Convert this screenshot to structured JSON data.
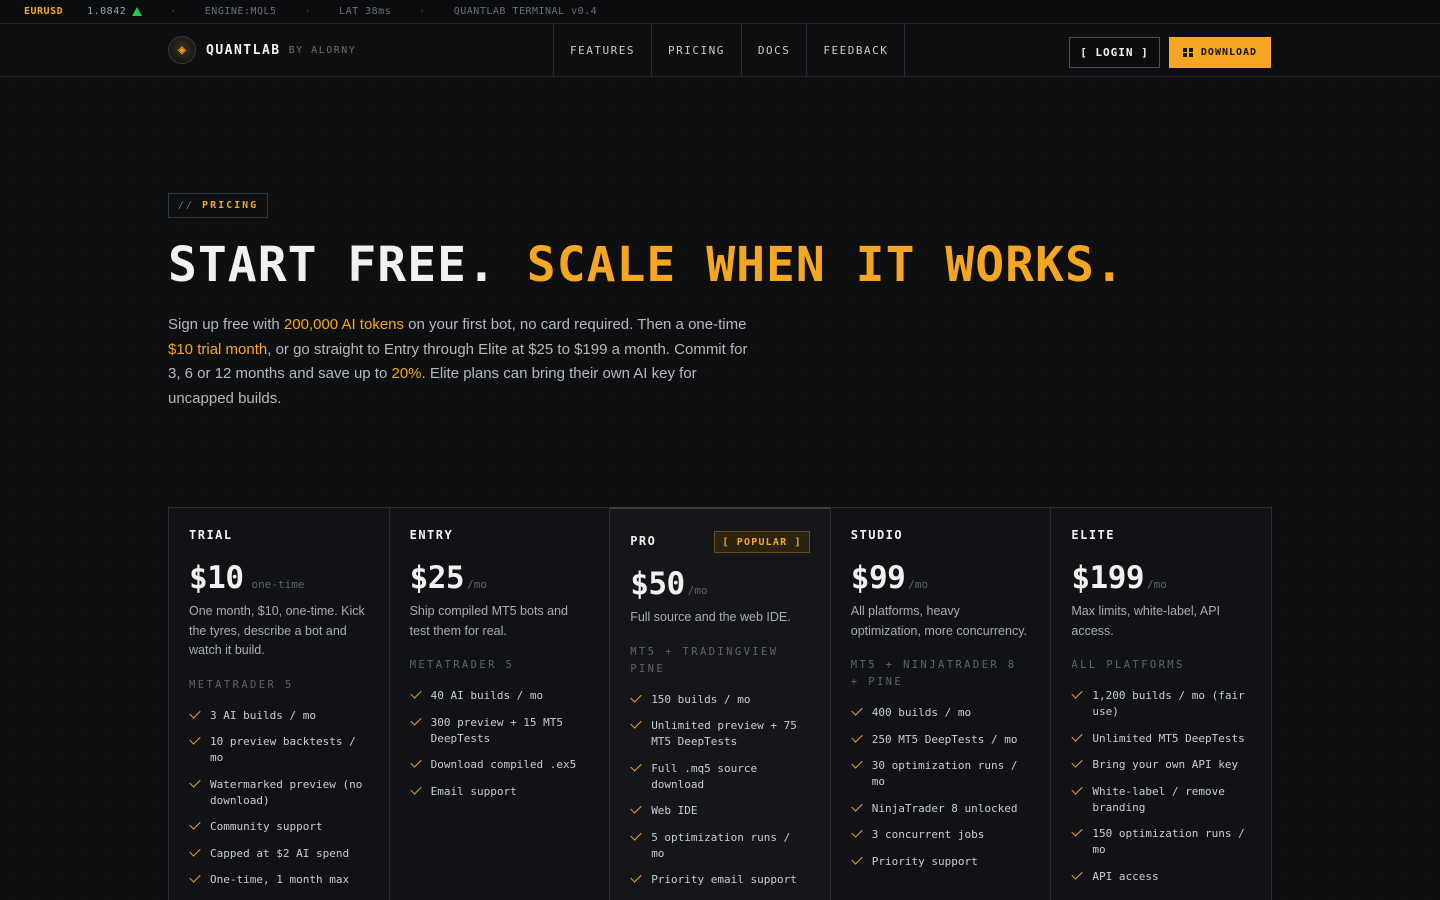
{
  "ticker": {
    "symbol": "EURUSD",
    "price": "1.0842",
    "engine": "ENGINE:MQL5",
    "latency": "LAT 38ms",
    "terminal": "QUANTLAB TERMINAL v0.4",
    "separator": "·"
  },
  "nav": {
    "brand": "QUANTLAB",
    "brand_by": "BY ALORNY",
    "links": [
      "FEATURES",
      "PRICING",
      "DOCS",
      "FEEDBACK"
    ],
    "login": "[ LOGIN ]",
    "download": "DOWNLOAD"
  },
  "hero": {
    "eyebrow_prefix": "//",
    "eyebrow": "PRICING",
    "headline_white": "START FREE.",
    "headline_orange": "SCALE WHEN IT WORKS.",
    "lede": [
      {
        "t": "Sign up free with ",
        "h": false
      },
      {
        "t": "200,000 AI tokens",
        "h": true
      },
      {
        "t": " on your first bot, no card required. Then a one-time ",
        "h": false
      },
      {
        "t": "$10 trial month",
        "h": true
      },
      {
        "t": ", or go straight to Entry through Elite at $25 to $199 a month. Commit for 3, 6 or 12 months and save up to ",
        "h": false
      },
      {
        "t": "20%",
        "h": true
      },
      {
        "t": ". Elite plans can bring their own AI key for uncapped builds.",
        "h": false
      }
    ]
  },
  "plans": [
    {
      "name": "TRIAL",
      "price": "$10",
      "per": "one-time",
      "desc": "One month, $10, one-time. Kick the tyres, describe a bot and watch it build.",
      "platform": "METATRADER 5",
      "features": [
        "3 AI builds / mo",
        "10 preview backtests / mo",
        "Watermarked preview (no download)",
        "Community support",
        "Capped at $2 AI spend",
        "One-time, 1 month max"
      ]
    },
    {
      "name": "ENTRY",
      "price": "$25",
      "per": "/mo",
      "desc": "Ship compiled MT5 bots and test them for real.",
      "platform": "METATRADER 5",
      "features": [
        "40 AI builds / mo",
        "300 preview + 15 MT5 DeepTests",
        "Download compiled .ex5",
        "Email support"
      ]
    },
    {
      "name": "PRO",
      "price": "$50",
      "per": "/mo",
      "badge": "[ POPULAR ]",
      "desc": "Full source and the web IDE.",
      "platform": "MT5 + TRADINGVIEW PINE",
      "features": [
        "150 builds / mo",
        "Unlimited preview + 75 MT5 DeepTests",
        "Full .mq5 source download",
        "Web IDE",
        "5 optimization runs / mo",
        "Priority email support"
      ]
    },
    {
      "name": "STUDIO",
      "price": "$99",
      "per": "/mo",
      "desc": "All platforms, heavy optimization, more concurrency.",
      "platform": "MT5 + NINJATRADER 8 + PINE",
      "features": [
        "400 builds / mo",
        "250 MT5 DeepTests / mo",
        "30 optimization runs / mo",
        "NinjaTrader 8 unlocked",
        "3 concurrent jobs",
        "Priority support"
      ]
    },
    {
      "name": "ELITE",
      "price": "$199",
      "per": "/mo",
      "desc": "Max limits, white-label, API access.",
      "platform": "ALL PLATFORMS",
      "features": [
        "1,200 builds / mo (fair use)",
        "Unlimited MT5 DeepTests",
        "Bring your own API key",
        "White-label / remove branding",
        "150 optimization runs / mo",
        "API access"
      ]
    }
  ],
  "colors": {
    "accent": "#f5a623",
    "up": "#22c55e",
    "bg": "#0e0f11"
  }
}
